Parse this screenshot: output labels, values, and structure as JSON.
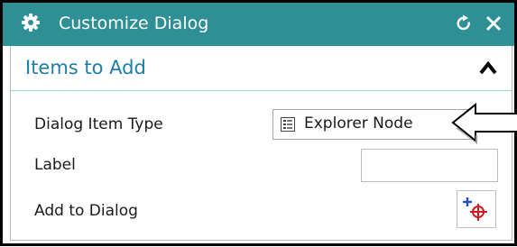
{
  "window": {
    "title": "Customize Dialog",
    "title_bar_color": "#2e8f94",
    "icons": {
      "settings": "gear-icon",
      "reset": "reset-icon",
      "close": "close-icon"
    }
  },
  "group": {
    "title": "Items to Add",
    "title_color": "#1f7ea8",
    "collapse_icon": "chevron-up-icon"
  },
  "fields": {
    "dialog_item_type": {
      "label": "Dialog Item Type",
      "value": "Explorer Node",
      "icon": "explorer-node-icon"
    },
    "label": {
      "label": "Label",
      "value": ""
    },
    "add_to_dialog": {
      "label": "Add to Dialog",
      "icon": "add-point-icon"
    }
  },
  "annotation": {
    "icon": "callout-arrow-icon"
  }
}
